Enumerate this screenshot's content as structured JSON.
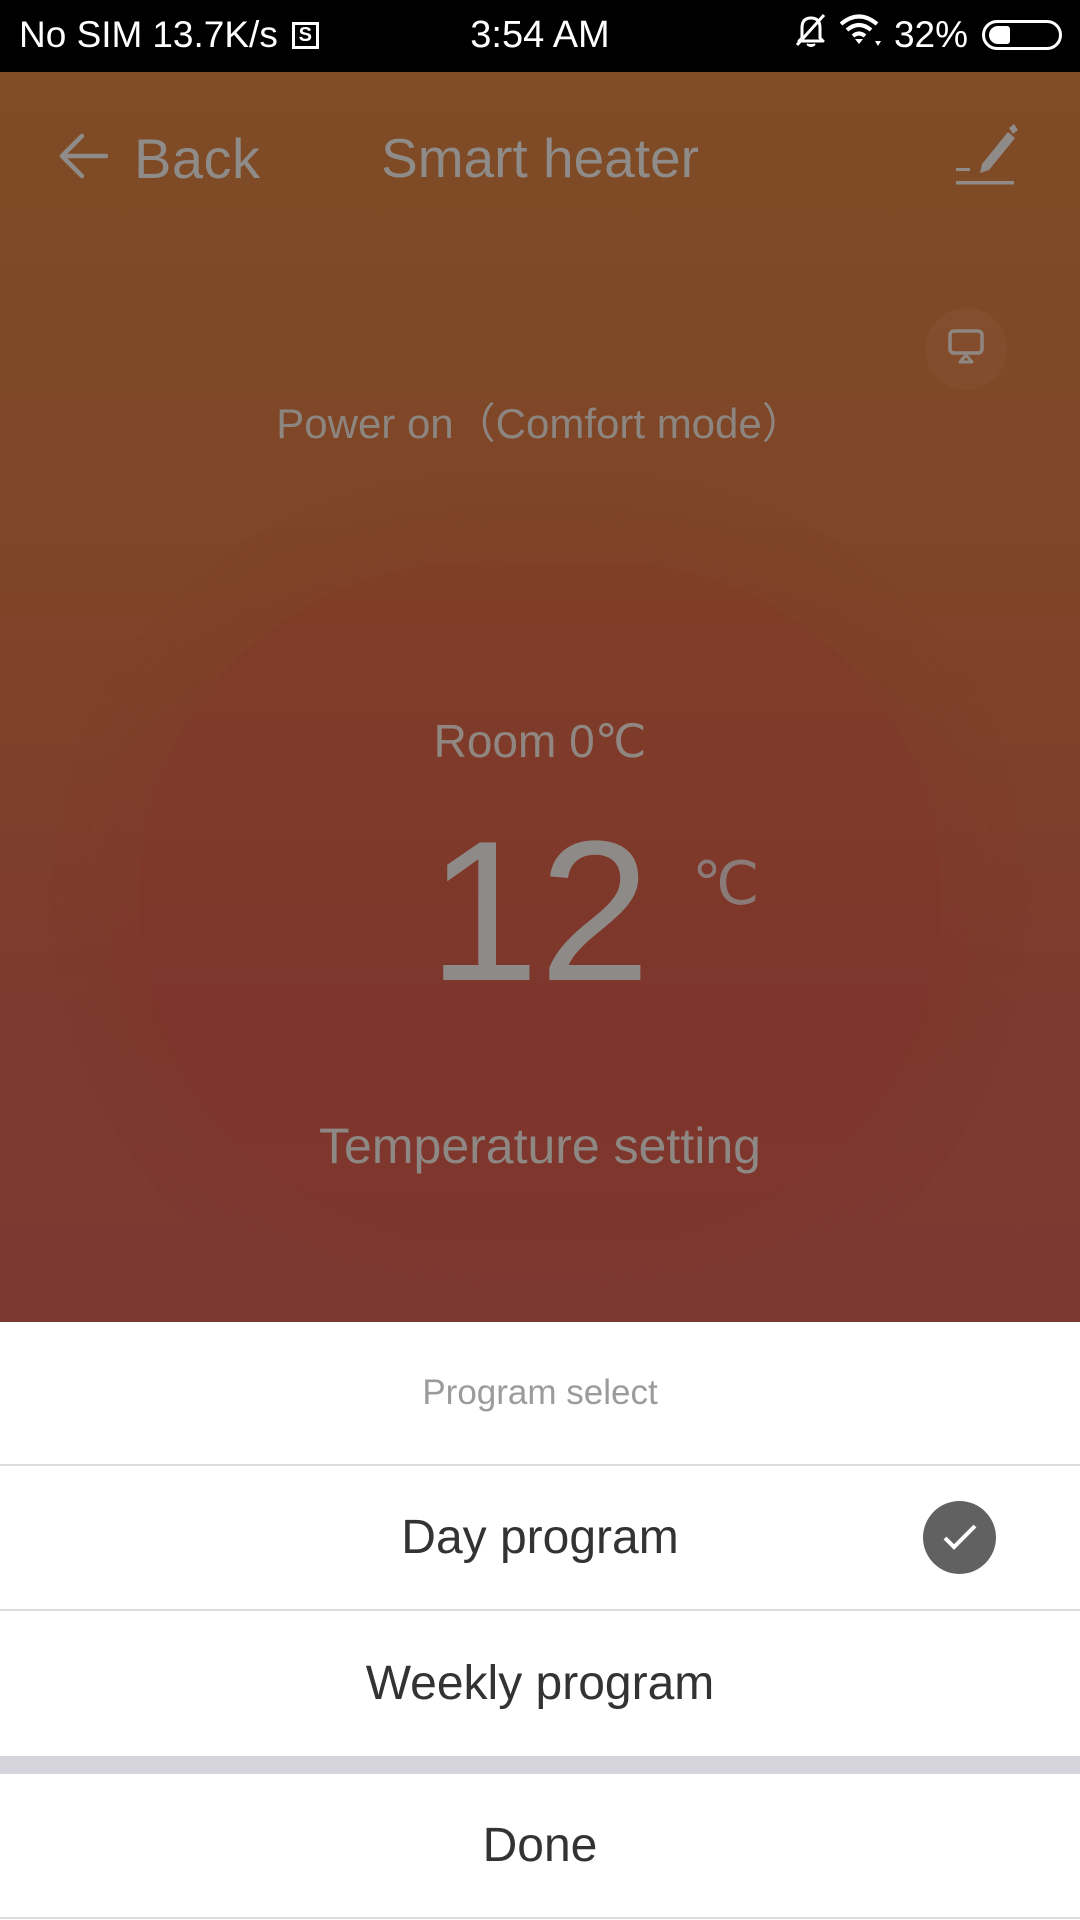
{
  "status_bar": {
    "carrier": "No SIM",
    "net_speed": "13.7K/s",
    "sim_icon_glyph": "S",
    "time": "3:54 AM",
    "battery_percent_text": "32%",
    "battery_level": 0.32,
    "icons": [
      "sim-s-icon",
      "bell-muted-icon",
      "wifi-icon",
      "battery-icon"
    ]
  },
  "nav": {
    "back_label": "Back",
    "title": "Smart heater",
    "back_icon": "arrow-left-icon",
    "edit_icon": "pencil-edit-icon"
  },
  "device": {
    "display_icon": "monitor-icon",
    "power_status": "Power on（Comfort mode）",
    "room_temp": "Room 0℃",
    "set_temp_value": "12",
    "set_temp_unit": "℃",
    "set_temp_label": "Temperature setting"
  },
  "sheet": {
    "title": "Program select",
    "options": [
      {
        "label": "Day program",
        "selected": true
      },
      {
        "label": "Weekly program",
        "selected": false
      }
    ],
    "done_label": "Done",
    "check_icon": "checkmark-circle-icon"
  },
  "colors": {
    "overlay_top": "#7f4c26",
    "overlay_bottom": "#7c3932",
    "check_bg": "#616161",
    "sheet_gap": "#d6d5dd",
    "divider": "#dcdcdc"
  }
}
